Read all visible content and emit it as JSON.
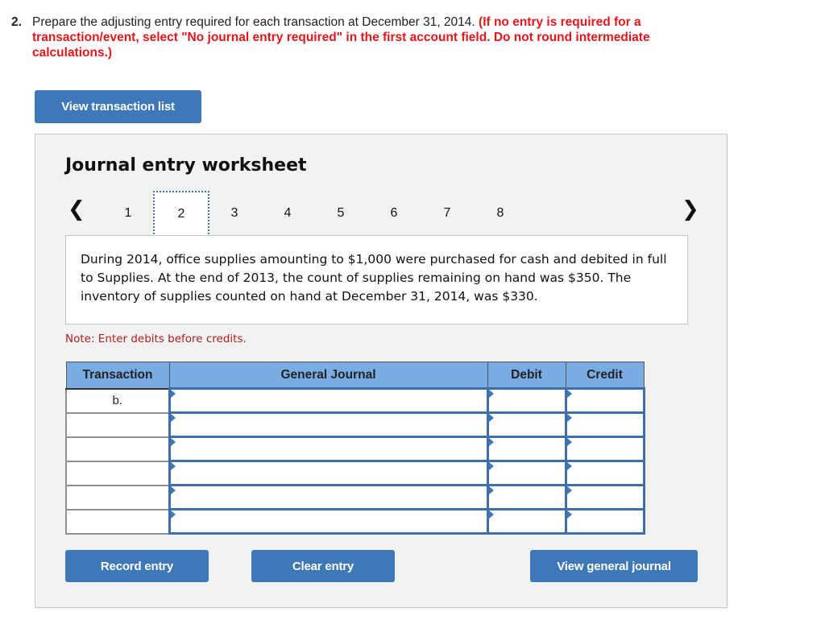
{
  "question": {
    "number": "2.",
    "text": "Prepare the adjusting entry required for each transaction at December 31, 2014.",
    "instruction": "(If no entry is required for a transaction/event, select \"No journal entry required\" in the first account field. Do not round intermediate calculations.)"
  },
  "buttons": {
    "view_transaction_list": "View transaction list",
    "record_entry": "Record entry",
    "clear_entry": "Clear entry",
    "view_general_journal": "View general journal"
  },
  "worksheet": {
    "title": "Journal entry worksheet",
    "pager": {
      "prev_icon": "chevron-left",
      "next_icon": "chevron-right",
      "pages": [
        "1",
        "2",
        "3",
        "4",
        "5",
        "6",
        "7",
        "8"
      ],
      "active_page": "2"
    },
    "description": "During 2014, office supplies amounting to $1,000 were purchased for cash and debited in full to Supplies. At the end of 2013, the count of supplies remaining on hand was $350. The inventory of supplies counted on hand at December 31, 2014, was $330.",
    "note": "Note: Enter debits before credits.",
    "table": {
      "headers": [
        "Transaction",
        "General Journal",
        "Debit",
        "Credit"
      ],
      "rows": [
        {
          "transaction": "b.",
          "account": "",
          "debit": "",
          "credit": ""
        },
        {
          "transaction": "",
          "account": "",
          "debit": "",
          "credit": ""
        },
        {
          "transaction": "",
          "account": "",
          "debit": "",
          "credit": ""
        },
        {
          "transaction": "",
          "account": "",
          "debit": "",
          "credit": ""
        },
        {
          "transaction": "",
          "account": "",
          "debit": "",
          "credit": ""
        },
        {
          "transaction": "",
          "account": "",
          "debit": "",
          "credit": ""
        }
      ]
    }
  },
  "colors": {
    "button_blue": "#3f78b9",
    "header_blue": "#79ace2",
    "instruction_red": "#e8161b",
    "note_red": "#b41b1b",
    "panel_bg": "#f2f2f2"
  }
}
